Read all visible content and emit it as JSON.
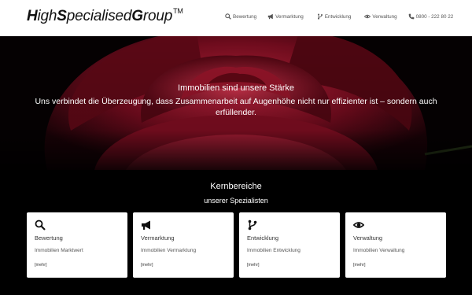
{
  "logo": {
    "parts": [
      "H",
      "igh",
      "S",
      "pecialised",
      "G",
      "roup"
    ],
    "trademark": "TM"
  },
  "nav": {
    "items": [
      {
        "label": "Bewertung",
        "icon": "search-icon"
      },
      {
        "label": "Vermarktung",
        "icon": "megaphone-icon"
      },
      {
        "label": "Entwicklung",
        "icon": "branch-icon"
      },
      {
        "label": "Verwaltung",
        "icon": "eye-icon"
      }
    ],
    "phone": {
      "label": "0800 - 222 80 22",
      "icon": "phone-icon"
    }
  },
  "hero": {
    "title": "Immobilien sind unsere Stärke",
    "subtitle": "Uns verbindet die Überzeugung, dass Zusammenarbeit auf Augenhöhe nicht nur effizienter ist – sondern auch erfüllender."
  },
  "section": {
    "title": "Kernbereiche",
    "subtitle": "unserer Spezialisten"
  },
  "cards": [
    {
      "title": "Bewertung",
      "description": "Immobilien Marktwert",
      "more": "[mehr]",
      "icon": "search-icon"
    },
    {
      "title": "Vermarktung",
      "description": "Immobilien Vermarktung",
      "more": "[mehr]",
      "icon": "megaphone-icon"
    },
    {
      "title": "Entwicklung",
      "description": "Immobilien Entwicklung",
      "more": "[mehr]",
      "icon": "branch-icon"
    },
    {
      "title": "Verwaltung",
      "description": "Immobilien Verwaltung",
      "more": "[mehr]",
      "icon": "eye-icon"
    }
  ],
  "colors": {
    "header_bg": "#ffffff",
    "page_bg": "#000000",
    "rose": "#8a0f24",
    "text_light": "#ffffff"
  }
}
